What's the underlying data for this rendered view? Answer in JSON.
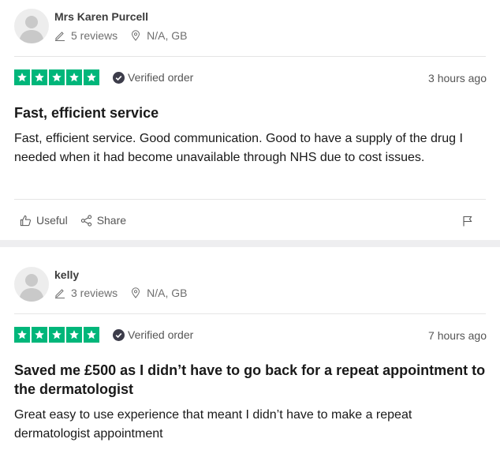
{
  "reviews": [
    {
      "reviewer_name": "Mrs Karen Purcell",
      "review_count": "5 reviews",
      "location": "N/A, GB",
      "rating": 5,
      "verified_label": "Verified order",
      "time_ago": "3 hours ago",
      "title": "Fast, efficient service",
      "body": "Fast, efficient service. Good communication. Good to have a supply of the drug I needed when it had become unavailable through NHS due to cost issues.",
      "useful_label": "Useful",
      "share_label": "Share"
    },
    {
      "reviewer_name": "kelly",
      "review_count": "3 reviews",
      "location": "N/A, GB",
      "rating": 5,
      "verified_label": "Verified order",
      "time_ago": "7 hours ago",
      "title": "Saved me £500 as I didn’t have to go back for a repeat appointment to the dermatologist",
      "body": "Great easy to use experience that meant I didn’t have to make a repeat dermatologist appointment"
    }
  ],
  "colors": {
    "star_green": "#00b67a",
    "separator": "#eeeef0",
    "text": "#191919",
    "muted": "#6f6f6f"
  }
}
